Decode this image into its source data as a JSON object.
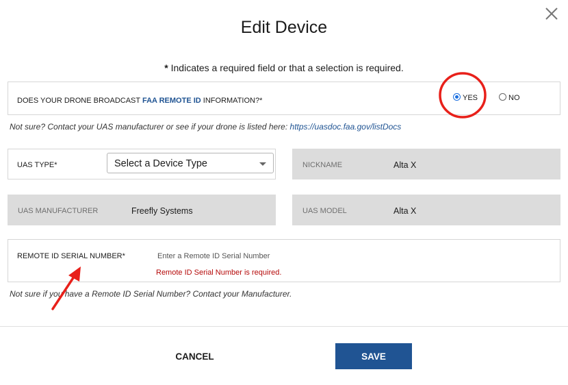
{
  "dialog": {
    "title": "Edit Device",
    "required_note_star": "*",
    "required_note_text": " Indicates a required field or that a selection is required."
  },
  "broadcast": {
    "question_prefix": "DOES YOUR DRONE BROADCAST ",
    "question_highlight": "FAA REMOTE ID",
    "question_suffix": " INFORMATION?*",
    "options": [
      {
        "label": "YES",
        "selected": true
      },
      {
        "label": "NO",
        "selected": false
      }
    ],
    "hint_text": "Not sure? Contact your UAS manufacturer or see if your drone is listed here: ",
    "hint_link": "https://uasdoc.faa.gov/listDocs"
  },
  "uas_type": {
    "label": "UAS TYPE*",
    "selected": "Select a Device Type"
  },
  "nickname": {
    "label": "NICKNAME",
    "value": "Alta X"
  },
  "manufacturer": {
    "label": "UAS MANUFACTURER",
    "value": "Freefly Systems"
  },
  "model": {
    "label": "UAS MODEL",
    "value": "Alta X"
  },
  "remote_id": {
    "label": "REMOTE ID SERIAL NUMBER*",
    "placeholder": "Enter a Remote ID Serial Number",
    "error": "Remote ID Serial Number is required.",
    "hint": "Not sure if you have a Remote ID Serial Number? Contact your Manufacturer."
  },
  "footer": {
    "cancel_label": "CANCEL",
    "save_label": "SAVE"
  },
  "annotation_colors": {
    "circle": "#e8201a",
    "arrow": "#e8201a"
  },
  "icons": {
    "close": "close-icon",
    "caret": "chevron-down-icon"
  }
}
